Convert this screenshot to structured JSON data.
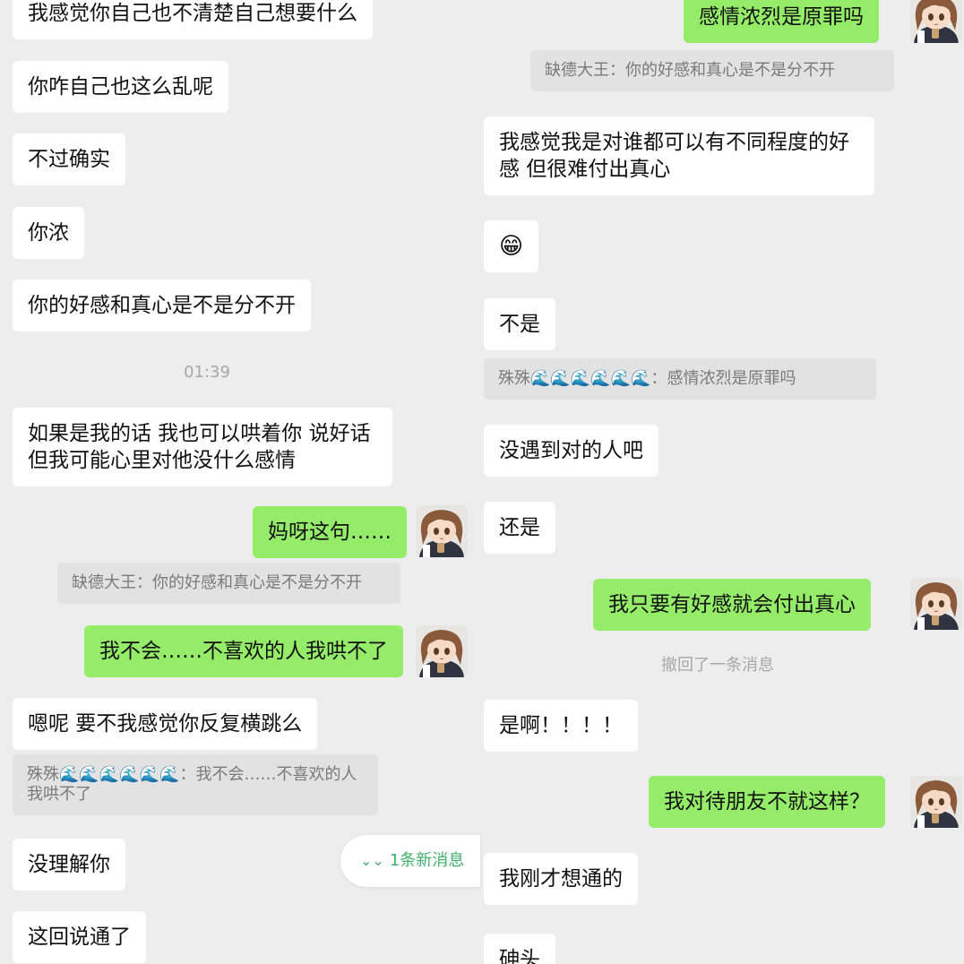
{
  "left_chat": {
    "messages": [
      {
        "text": "我感觉你自己也不清楚自己想要什么"
      },
      {
        "text": "你咋自己也这么乱呢"
      },
      {
        "text": "不过确实"
      },
      {
        "text": "你浓"
      },
      {
        "text": "你的好感和真心是不是分不开"
      },
      {
        "time": "01:39"
      },
      {
        "text": "如果是我的话 我也可以哄着你 说好话 但我可能心里对他没什么感情"
      },
      {
        "text": "妈呀这句……"
      },
      {
        "quote": "缺德大王：你的好感和真心是不是分不开"
      },
      {
        "text": "我不会……不喜欢的人我哄不了"
      },
      {
        "text": "嗯呢 要不我感觉你反复横跳么"
      },
      {
        "quote": "殊殊🌊🌊🌊🌊🌊🌊：我不会……不喜欢的人我哄不了"
      },
      {
        "text": "没理解你"
      },
      {
        "text": "这回说通了"
      }
    ],
    "new_messages_label": "1条新消息"
  },
  "right_chat": {
    "messages": [
      {
        "text": "感情浓烈是原罪吗"
      },
      {
        "quote": "缺德大王：你的好感和真心是不是分不开"
      },
      {
        "text": "我感觉我是对谁都可以有不同程度的好感 但很难付出真心"
      },
      {
        "emoji": "😁"
      },
      {
        "text": "不是"
      },
      {
        "quote": "殊殊🌊🌊🌊🌊🌊🌊：感情浓烈是原罪吗"
      },
      {
        "text": "没遇到对的人吧"
      },
      {
        "text": "还是"
      },
      {
        "text": "我只要有好感就会付出真心"
      },
      {
        "notice": "撤回了一条消息"
      },
      {
        "text": "是啊！！！！"
      },
      {
        "text": "我对待朋友不就这样？"
      },
      {
        "text": "我刚才想通的"
      },
      {
        "text": "砷头"
      }
    ]
  },
  "icons": {
    "new_messages": "double-chevron-down-icon",
    "avatar": "anime-girl-avatar"
  },
  "colors": {
    "background": "#ededed",
    "sent_bubble": "#95ec69",
    "received_bubble": "#ffffff",
    "accent": "#3fb06a"
  }
}
